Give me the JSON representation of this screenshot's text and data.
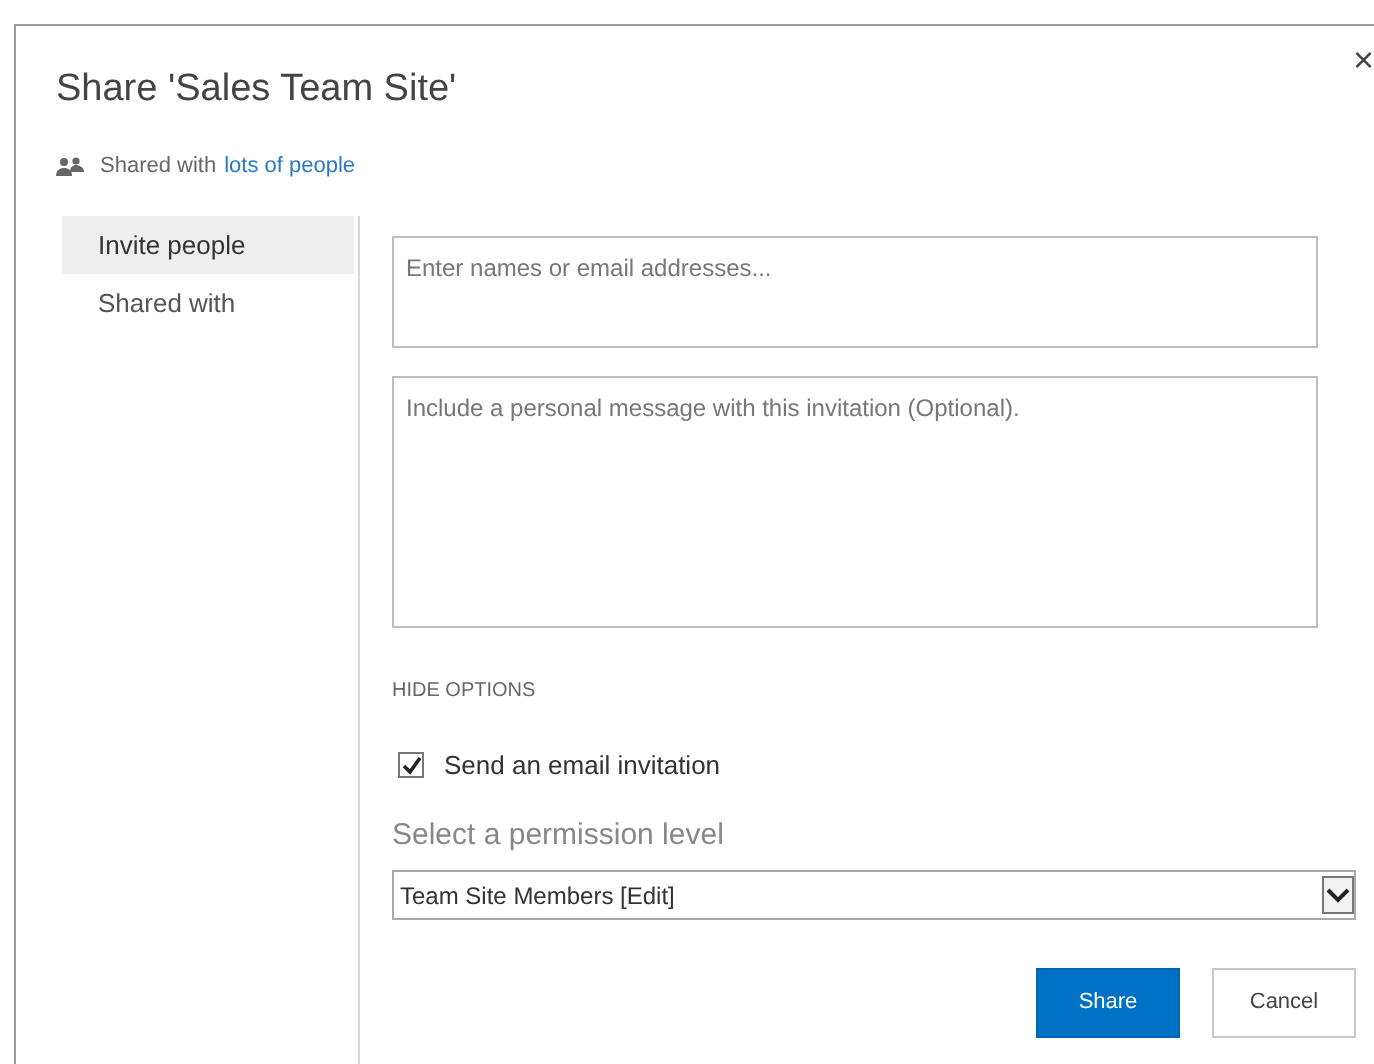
{
  "dialog": {
    "title": "Share 'Sales Team Site'",
    "close": "×",
    "shared_with": {
      "label": "Shared with",
      "link": "lots of people"
    }
  },
  "sidebar": {
    "items": [
      {
        "label": "Invite people",
        "selected": true
      },
      {
        "label": "Shared with",
        "selected": false
      }
    ]
  },
  "names_field": {
    "placeholder": "Enter names or email addresses..."
  },
  "message_field": {
    "placeholder": "Include a personal message with this invitation (Optional)."
  },
  "options_toggle": "HIDE OPTIONS",
  "email_invitation": {
    "label": "Send an email invitation",
    "checked": true
  },
  "permission": {
    "label": "Select a permission level",
    "value": "Team Site Members [Edit]"
  },
  "buttons": [
    {
      "label": "Share",
      "kind": "primary"
    },
    {
      "label": "Cancel",
      "kind": "secondary"
    }
  ]
}
